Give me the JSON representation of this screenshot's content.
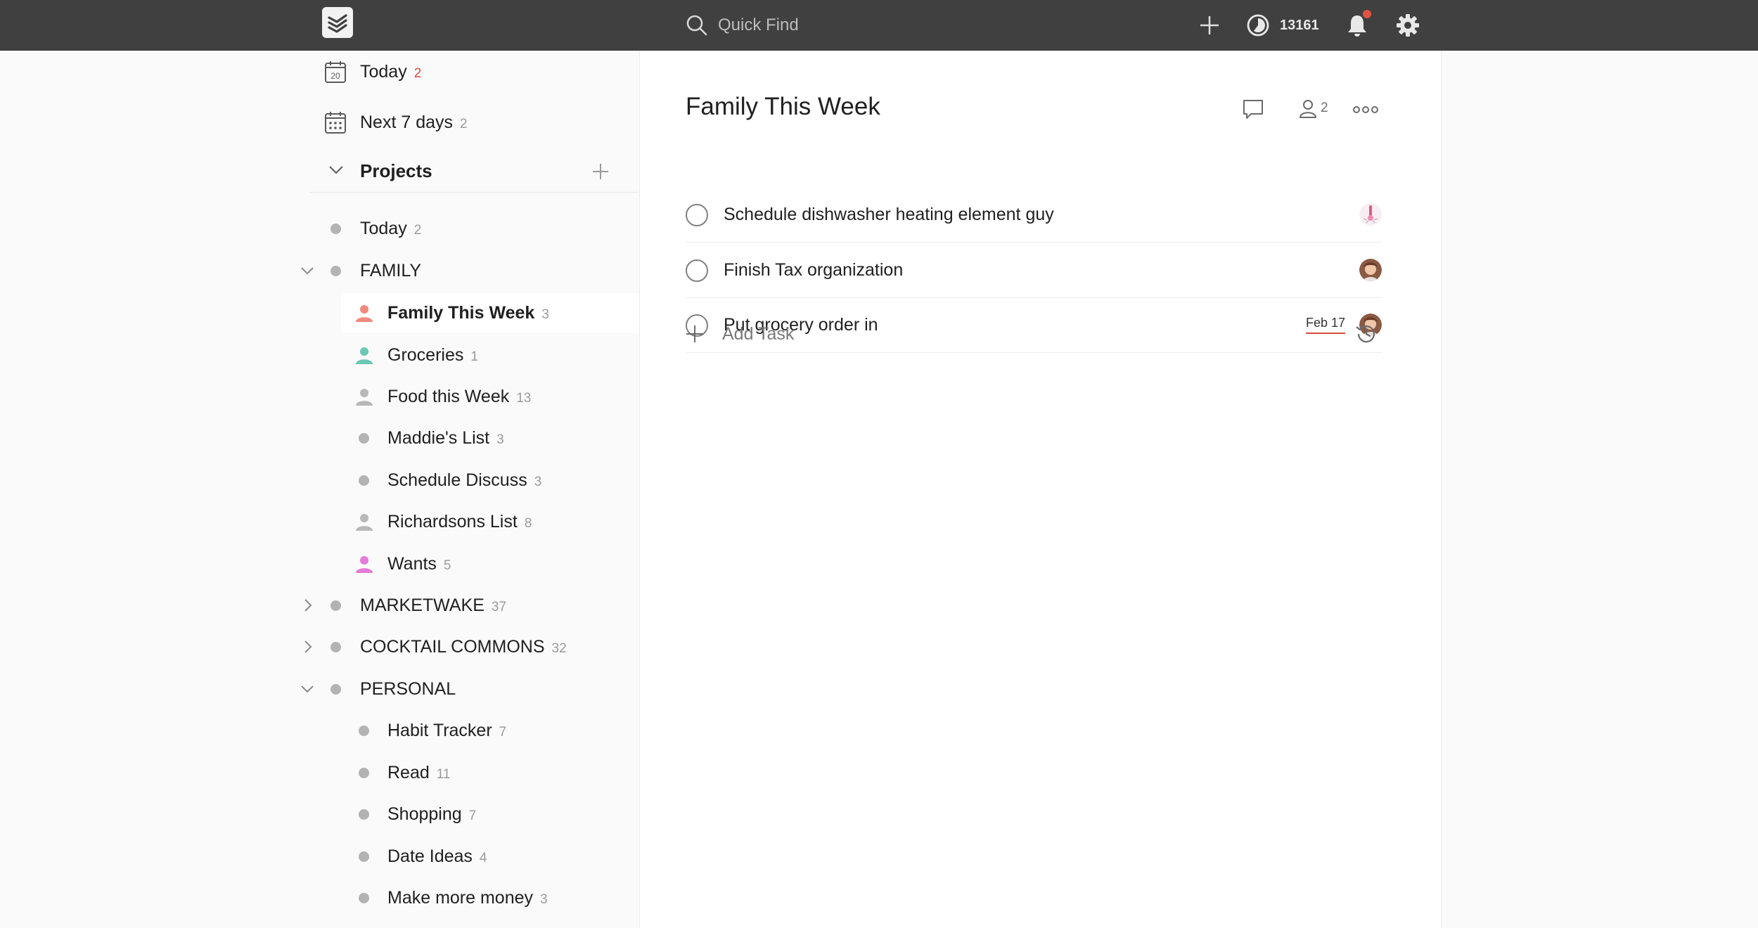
{
  "topbar": {
    "search_placeholder": "Quick Find",
    "karma": "13161"
  },
  "sidebar": {
    "filters": [
      {
        "label": "Today",
        "count": "2",
        "calendar_day": "20"
      },
      {
        "label": "Next 7 days",
        "count": "2"
      }
    ],
    "projects_title": "Projects",
    "projects": [
      {
        "label": "Today",
        "count": "2"
      },
      {
        "label": "FAMILY",
        "count": ""
      },
      {
        "label": "Family This Week",
        "count": "3"
      },
      {
        "label": "Groceries",
        "count": "1"
      },
      {
        "label": "Food this Week",
        "count": "13"
      },
      {
        "label": "Maddie's List",
        "count": "3"
      },
      {
        "label": "Schedule Discuss",
        "count": "3"
      },
      {
        "label": "Richardsons List",
        "count": "8"
      },
      {
        "label": "Wants",
        "count": "5"
      },
      {
        "label": "MARKETWAKE",
        "count": "37"
      },
      {
        "label": "COCKTAIL COMMONS",
        "count": "32"
      },
      {
        "label": "PERSONAL",
        "count": ""
      },
      {
        "label": "Habit Tracker",
        "count": "7"
      },
      {
        "label": "Read",
        "count": "11"
      },
      {
        "label": "Shopping",
        "count": "7"
      },
      {
        "label": "Date Ideas",
        "count": "4"
      },
      {
        "label": "Make more money",
        "count": "3"
      }
    ]
  },
  "main": {
    "title": "Family This Week",
    "members_count": "2",
    "tasks": [
      {
        "text": "Schedule dishwasher heating element guy",
        "due": ""
      },
      {
        "text": "Finish Tax organization",
        "due": ""
      },
      {
        "text": "Put grocery order in",
        "due": "Feb 17"
      }
    ],
    "add_task_label": "Add Task"
  },
  "colors": {
    "topbar": "#404040",
    "accent_red": "#db4c3f",
    "person_salmon": "#f08a7e",
    "person_teal": "#6cc7b4",
    "person_gray": "#b8b8b8",
    "person_pink": "#e67ad8"
  },
  "icons": [
    "todoist-logo-icon",
    "search-icon",
    "plus-icon",
    "karma-icon",
    "bell-icon",
    "gear-icon",
    "calendar-icon",
    "calendar-week-icon",
    "chevron-down-icon",
    "chevron-right-icon",
    "person-icon",
    "comment-icon",
    "members-icon",
    "more-icon",
    "history-icon"
  ]
}
